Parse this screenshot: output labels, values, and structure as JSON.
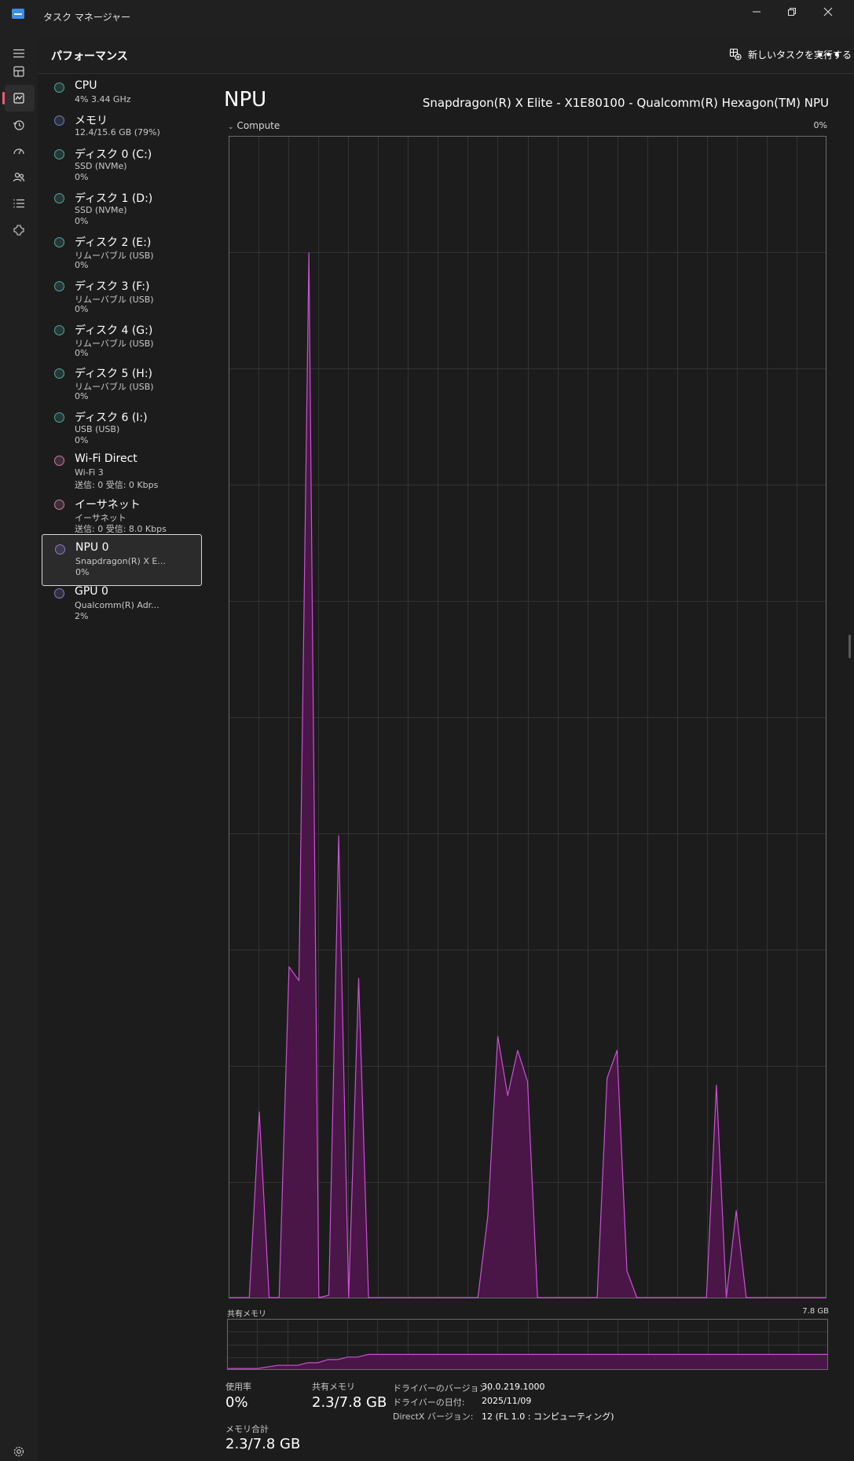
{
  "app": {
    "title": "タスク マネージャー"
  },
  "header": {
    "section_title": "パフォーマンス",
    "run_task_label": "新しいタスクを実行する"
  },
  "colors": {
    "accent": "#c854d2",
    "fill": "#4a1547",
    "dot_teal": "#4fa7a0",
    "dot_blue": "#6c80c8",
    "dot_pink": "#c87aa6",
    "dot_purple": "#8a7ac8"
  },
  "devices": [
    {
      "name": "CPU",
      "sub": "4%  3.44 GHz",
      "sub2": "",
      "dot": "dot_teal"
    },
    {
      "name": "メモリ",
      "sub": "12.4/15.6 GB (79%)",
      "sub2": "",
      "dot": "dot_blue"
    },
    {
      "name": "ディスク 0 (C:)",
      "sub": "SSD (NVMe)",
      "sub2": "0%",
      "dot": "dot_teal"
    },
    {
      "name": "ディスク 1 (D:)",
      "sub": "SSD (NVMe)",
      "sub2": "0%",
      "dot": "dot_teal"
    },
    {
      "name": "ディスク 2 (E:)",
      "sub": "リムーバブル (USB)",
      "sub2": "0%",
      "dot": "dot_teal"
    },
    {
      "name": "ディスク 3 (F:)",
      "sub": "リムーバブル (USB)",
      "sub2": "0%",
      "dot": "dot_teal"
    },
    {
      "name": "ディスク 4 (G:)",
      "sub": "リムーバブル (USB)",
      "sub2": "0%",
      "dot": "dot_teal"
    },
    {
      "name": "ディスク 5 (H:)",
      "sub": "リムーバブル (USB)",
      "sub2": "0%",
      "dot": "dot_teal"
    },
    {
      "name": "ディスク 6 (I:)",
      "sub": "USB (USB)",
      "sub2": "0%",
      "dot": "dot_teal"
    },
    {
      "name": "Wi-Fi Direct",
      "sub": "Wi-Fi 3",
      "sub2": "送信: 0 受信: 0 Kbps",
      "dot": "dot_pink"
    },
    {
      "name": "イーサネット",
      "sub": "イーサネット",
      "sub2": "送信: 0 受信: 8.0 Kbps",
      "dot": "dot_pink"
    },
    {
      "name": "NPU 0",
      "sub": "Snapdragon(R) X E...",
      "sub2": "0%",
      "dot": "dot_purple",
      "selected": true
    },
    {
      "name": "GPU 0",
      "sub": "Qualcomm(R) Adr...",
      "sub2": "2%",
      "dot": "dot_purple"
    }
  ],
  "main": {
    "title": "NPU",
    "model": "Snapdragon(R) X Elite - X1E80100 - Qualcomm(R) Hexagon(TM) NPU",
    "compute_label": "Compute",
    "compute_pct": "0%",
    "shared_memory_label": "共有メモリ",
    "shared_memory_max": "7.8 GB"
  },
  "stats": {
    "usage_label": "使用率",
    "usage_value": "0%",
    "shared_label": "共有メモリ",
    "shared_value": "2.3/7.8 GB",
    "total_label": "メモリ合計",
    "total_value": "2.3/7.8 GB"
  },
  "info": [
    {
      "key": "ドライバーのバージョン:",
      "value": "30.0.219.1000"
    },
    {
      "key": "ドライバーの日付:",
      "value": "2025/11/09"
    },
    {
      "key": "DirectX バージョン:",
      "value": "12 (FL 1.0 : コンピューティング)"
    }
  ],
  "chart_data": [
    {
      "type": "area",
      "title": "Compute",
      "ylim": [
        0,
        100
      ],
      "xlim": [
        0,
        60
      ],
      "grid": true,
      "x": [
        0,
        1,
        2,
        3,
        4,
        5,
        6,
        7,
        8,
        9,
        10,
        11,
        12,
        13,
        14,
        15,
        16,
        17,
        18,
        19,
        20,
        21,
        22,
        23,
        24,
        25,
        26,
        27,
        28,
        29,
        30,
        31,
        32,
        33,
        34,
        35,
        36,
        37,
        38,
        39,
        40,
        41,
        42,
        43,
        44,
        45,
        46,
        47,
        48,
        49,
        50,
        51,
        52,
        53,
        54,
        55,
        56,
        57,
        58,
        59,
        60
      ],
      "values": [
        0,
        0,
        0,
        16,
        0,
        0,
        28.5,
        27.3,
        90,
        0,
        0.2,
        39.8,
        0,
        27.5,
        0,
        0,
        0,
        0,
        0,
        0,
        0,
        0,
        0,
        0,
        0,
        0,
        7,
        22.5,
        17.4,
        21.3,
        18.6,
        0,
        0,
        0,
        0,
        0,
        0,
        0,
        18.9,
        21.3,
        2.3,
        0,
        0,
        0,
        0,
        0,
        0,
        0,
        0,
        18.3,
        0,
        7.5,
        0,
        0,
        0,
        0,
        0,
        0,
        0,
        0,
        0
      ]
    },
    {
      "type": "area",
      "title": "共有メモリ",
      "ylim": [
        0,
        7.8
      ],
      "xlim": [
        0,
        60
      ],
      "grid": true,
      "x": [
        0,
        3,
        5,
        7,
        8,
        9,
        10,
        11,
        12,
        13,
        14,
        15,
        60
      ],
      "values": [
        0.1,
        0.1,
        0.6,
        0.6,
        1.0,
        1.0,
        1.5,
        1.5,
        1.9,
        1.9,
        2.3,
        2.3,
        2.3
      ]
    }
  ]
}
